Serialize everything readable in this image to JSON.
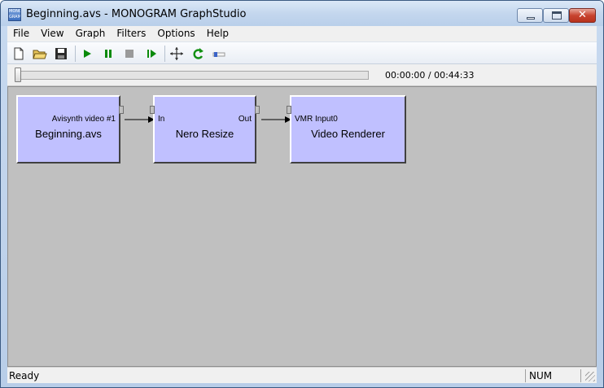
{
  "window": {
    "title": "Beginning.avs - MONOGRAM GraphStudio",
    "icon_label": "MONO GRAM"
  },
  "menu": [
    "File",
    "View",
    "Graph",
    "Filters",
    "Options",
    "Help"
  ],
  "toolbar": {
    "icons": [
      "new-file-icon",
      "open-folder-icon",
      "save-disk-icon",
      "play-icon",
      "pause-icon",
      "stop-icon",
      "frame-step-icon",
      "arrange-graph-icon",
      "refresh-icon",
      "slider-icon"
    ]
  },
  "seek": {
    "position_fraction": 0,
    "time": "00:00:00 / 00:44:33"
  },
  "filters": [
    {
      "name": "Beginning.avs",
      "output_pin": "Avisynth video #1",
      "input_pin": ""
    },
    {
      "name": "Nero Resize",
      "input_pin": "In",
      "output_pin": "Out"
    },
    {
      "name": "Video Renderer",
      "input_pin": "VMR Input0",
      "output_pin": ""
    }
  ],
  "status": {
    "text": "Ready",
    "num": "NUM"
  },
  "colors": {
    "filter_fill": "#c0c0ff",
    "canvas": "#c0c0c0",
    "play_green": "#0a8a0a"
  }
}
